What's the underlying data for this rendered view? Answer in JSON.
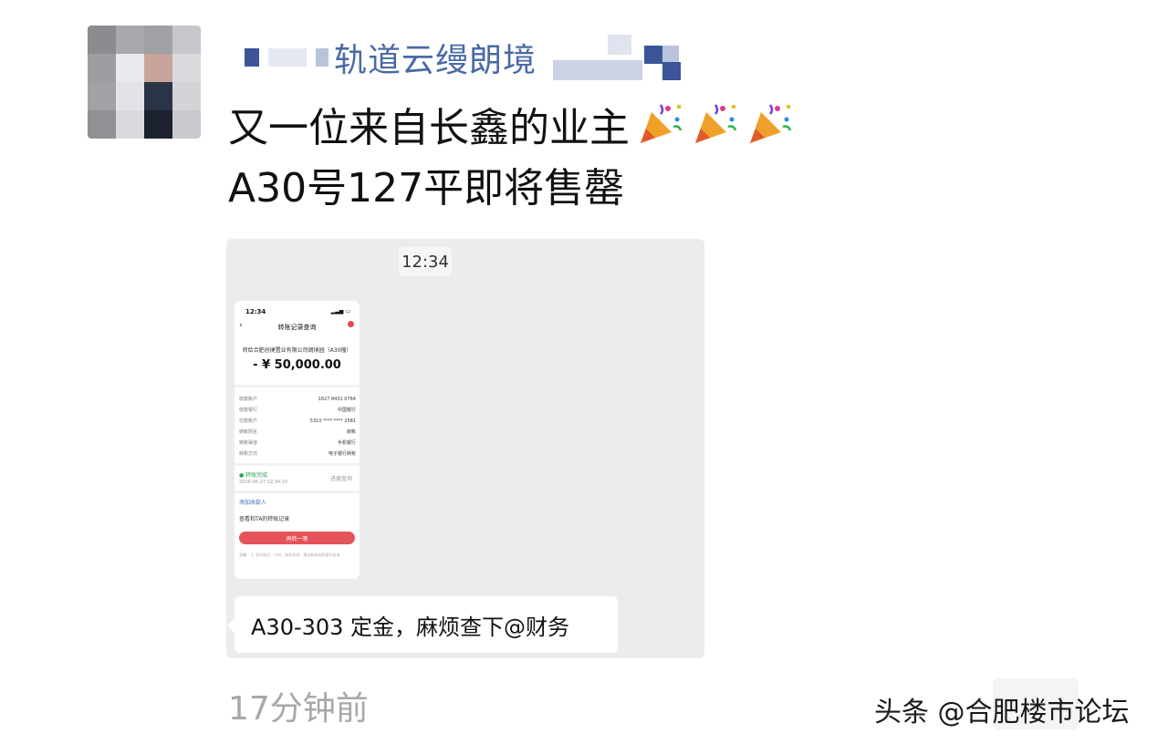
{
  "contact": {
    "name_visible": "轨道云缦朗境"
  },
  "message": {
    "line1": "又一位来自长鑫的业主",
    "line2": "A30号127平即将售罄"
  },
  "screenshot": {
    "time": "12:34",
    "phone": {
      "status_time": "12:34",
      "nav_title": "转账记录查询",
      "payee": "转给合肥创捷置业有限公司朗境园（A30幢）",
      "amount": "- ¥ 50,000.00",
      "rows": [
        {
          "label": "收款账户",
          "value": "1627 8431 0764"
        },
        {
          "label": "收款银行",
          "value": "中国银行"
        },
        {
          "label": "付款账户",
          "value": "5310 **** **** 2581"
        },
        {
          "label": "转账附言",
          "value": "转账"
        },
        {
          "label": "转账渠道",
          "value": "手机银行"
        },
        {
          "label": "转账方式",
          "value": "电子银行转账"
        }
      ],
      "status": "● 转账完成",
      "status_time_full": "2026-06-27 12:34:10",
      "progress": "进度查询",
      "link1": "添加收款人",
      "link2": "查看和TA的转账记录",
      "button": "再转一笔",
      "note": "温馨：\n1. 如付款后一小时，收款异常，建议联系收款银行查询"
    },
    "caption": "A30-303 定金，麻烦查下@财务"
  },
  "timestamp": "17分钟前",
  "watermark": "头条 @合肥楼市论坛",
  "colors": {
    "name_color": "#4a6aa6",
    "accent_red": "#e5535a",
    "status_green": "#2aa05a",
    "timestamp_gray": "#a8a8a8"
  }
}
